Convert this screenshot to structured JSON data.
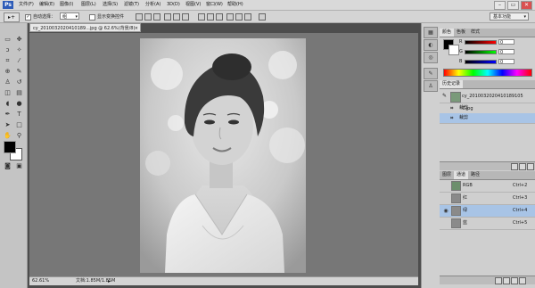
{
  "app": {
    "logo": "Ps"
  },
  "menubar": {
    "items": [
      "文件(F)",
      "编辑(E)",
      "图像(I)",
      "图层(L)",
      "选择(S)",
      "滤镜(T)",
      "分析(A)",
      "3D(D)",
      "视图(V)",
      "窗口(W)",
      "帮助(H)"
    ]
  },
  "window_controls": {
    "minimize": "–",
    "restore": "▭",
    "close": "✕"
  },
  "options_bar": {
    "auto_select_label": "自动选择：",
    "auto_select_value": "组",
    "show_transform_label": "显示变换控件",
    "workspace": "基本功能"
  },
  "document": {
    "tab_title": "cy_2010032020410189...jpg @ 62.6%(背景/8)",
    "zoom": "62.61%",
    "doc_info": "文档:1.85M/1.85M"
  },
  "colors": {
    "foreground": "#000000",
    "background": "#ffffff",
    "accent_selection": "#a8c4e6",
    "panel_bg": "#cfcfcf"
  },
  "color_panel": {
    "tabs": [
      "颜色",
      "色板",
      "样式"
    ],
    "channels": [
      {
        "label": "R",
        "value": "0"
      },
      {
        "label": "G",
        "value": "0"
      },
      {
        "label": "B",
        "value": "0"
      }
    ]
  },
  "history_panel": {
    "tabs": [
      "历史记录"
    ],
    "snapshot": "cy_2010032020410189105 7.jpg",
    "items": [
      "裁剪",
      "裁剪"
    ]
  },
  "layers_panel": {
    "tabs": [
      "图层",
      "通道",
      "路径"
    ],
    "layers": [
      {
        "name": "RGB",
        "shortcut": "Ctrl+2"
      },
      {
        "name": "红",
        "shortcut": "Ctrl+3"
      },
      {
        "name": "绿",
        "shortcut": "Ctrl+4"
      },
      {
        "name": "蓝",
        "shortcut": "Ctrl+5"
      }
    ]
  }
}
